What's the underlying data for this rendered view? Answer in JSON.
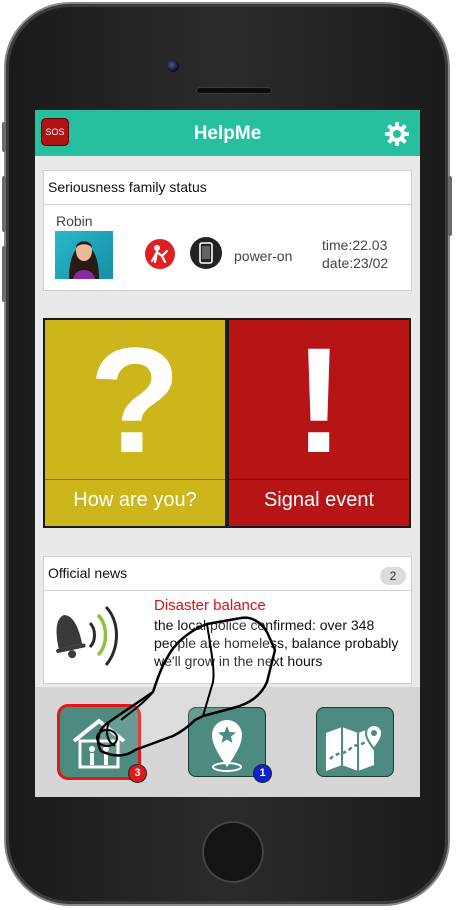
{
  "app": {
    "title": "HelpMe",
    "sos_label": "SOS",
    "accent_color": "#26c0a0",
    "icons": [
      "sos-icon",
      "gear-icon"
    ]
  },
  "family_status": {
    "header": "Seriousness family status",
    "member": {
      "name": "Robin",
      "status_icons": [
        "fall-alert-icon",
        "phone-icon"
      ],
      "power": "power-on",
      "time": "time:22.03",
      "date": "date:23/02"
    }
  },
  "tiles": [
    {
      "label": "How are you?",
      "symbol": "?",
      "color": "#cdb51c"
    },
    {
      "label": "Signal event",
      "symbol": "!",
      "color": "#b71515"
    }
  ],
  "news": {
    "header": "Official news",
    "count": "2",
    "title": "Disaster balance",
    "body": "the local police confirmed: over 348 people are homeless, balance probably we'll grow in the next hours",
    "icon": "bell-sound-icon"
  },
  "bottom_nav": [
    {
      "icon": "home-family-icon",
      "badge": "3",
      "badge_color": "#e01818",
      "active": true
    },
    {
      "icon": "map-pin-star-icon",
      "badge": "1",
      "badge_color": "#1020d0",
      "active": false
    },
    {
      "icon": "map-route-icon",
      "badge": "",
      "badge_color": "",
      "active": false
    }
  ]
}
